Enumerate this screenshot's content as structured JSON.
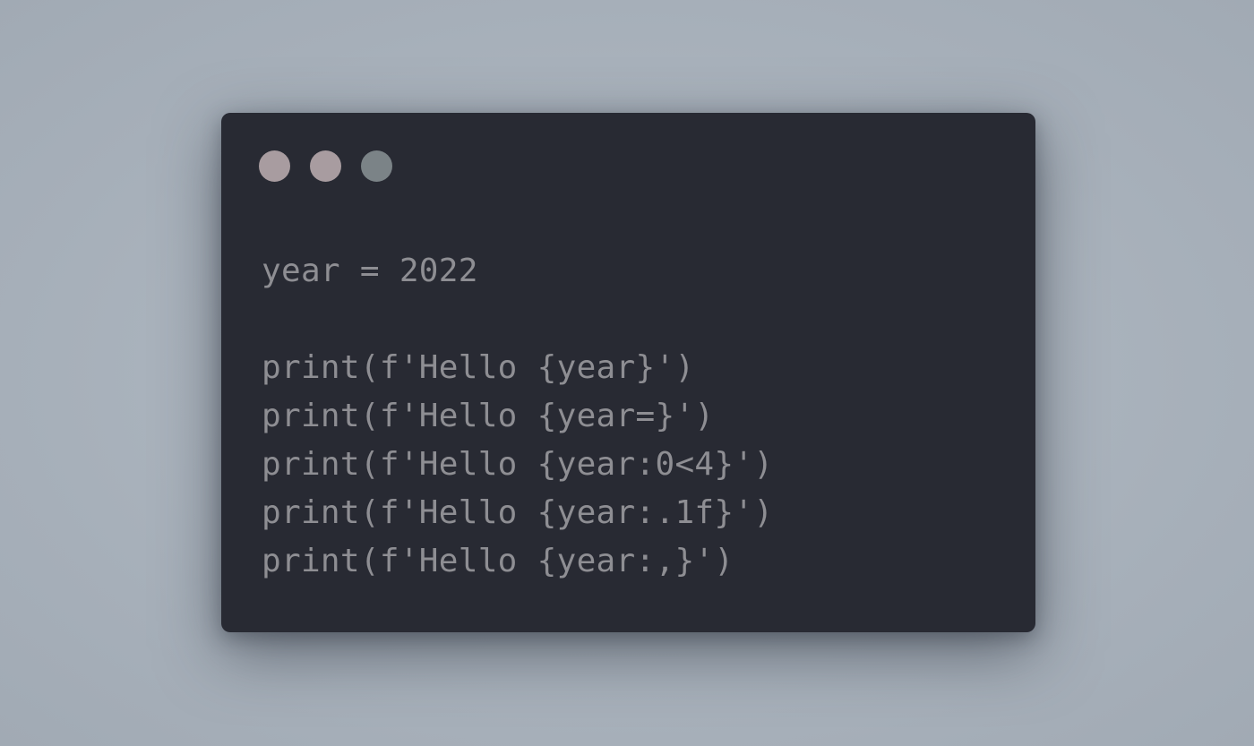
{
  "window": {
    "controls": [
      {
        "name": "close",
        "color": "#a89ca0"
      },
      {
        "name": "minimize",
        "color": "#a89ca0"
      },
      {
        "name": "zoom",
        "color": "#7b8387"
      }
    ]
  },
  "code": {
    "lines": [
      "year = 2022",
      "",
      "print(f'Hello {year}')",
      "print(f'Hello {year=}')",
      "print(f'Hello {year:0<4}')",
      "print(f'Hello {year:.1f}')",
      "print(f'Hello {year:,}')"
    ]
  },
  "colors": {
    "background": "#a8b1bb",
    "window_background": "#282a33",
    "text": "#8e8e93"
  }
}
